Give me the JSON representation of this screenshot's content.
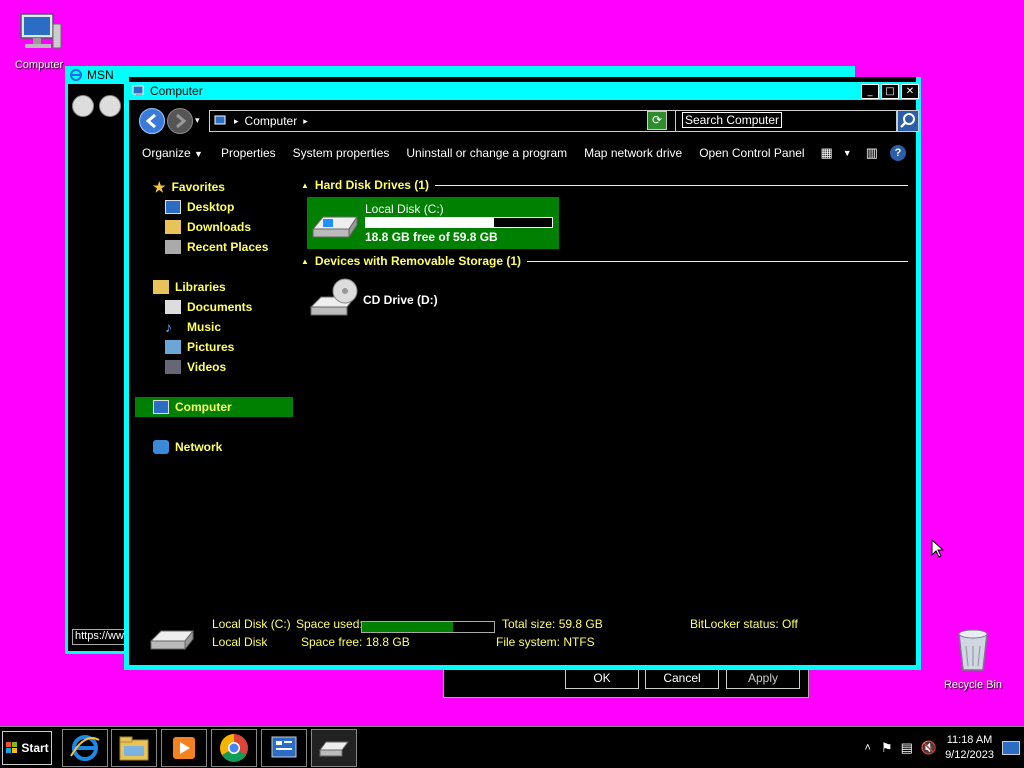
{
  "desktop": {
    "icons": [
      {
        "label": "Computer"
      },
      {
        "label": "Recycle Bin"
      }
    ]
  },
  "msn_window": {
    "title": "MSN",
    "url": "https://ww"
  },
  "explorer": {
    "title": "Computer",
    "address": "Computer",
    "search_placeholder": "Search Computer",
    "toolbar": [
      "Organize",
      "Properties",
      "System properties",
      "Uninstall or change a program",
      "Map network drive",
      "Open Control Panel"
    ],
    "nav": {
      "favorites": "Favorites",
      "desktop": "Desktop",
      "downloads": "Downloads",
      "recent": "Recent Places",
      "libraries": "Libraries",
      "documents": "Documents",
      "music": "Music",
      "pictures": "Pictures",
      "videos": "Videos",
      "computer": "Computer",
      "network": "Network"
    },
    "groups": {
      "hdd": "Hard Disk Drives (1)",
      "removable": "Devices with Removable Storage (1)"
    },
    "drive_c": {
      "name": "Local Disk (C:)",
      "free_text": "18.8 GB free of 59.8 GB",
      "used_fraction": 0.686
    },
    "drive_d": {
      "name": "CD Drive (D:)"
    },
    "details": {
      "name": "Local Disk (C:)",
      "type": "Local Disk",
      "space_used_label": "Space used:",
      "space_free": "Space free: 18.8 GB",
      "total_size": "Total size: 59.8 GB",
      "file_system": "File system: NTFS",
      "bitlocker": "BitLocker status: Off",
      "used_fraction": 0.686
    }
  },
  "dialog": {
    "ok": "OK",
    "cancel": "Cancel",
    "apply": "Apply"
  },
  "taskbar": {
    "start": "Start",
    "time": "11:18 AM",
    "date": "9/12/2023"
  }
}
